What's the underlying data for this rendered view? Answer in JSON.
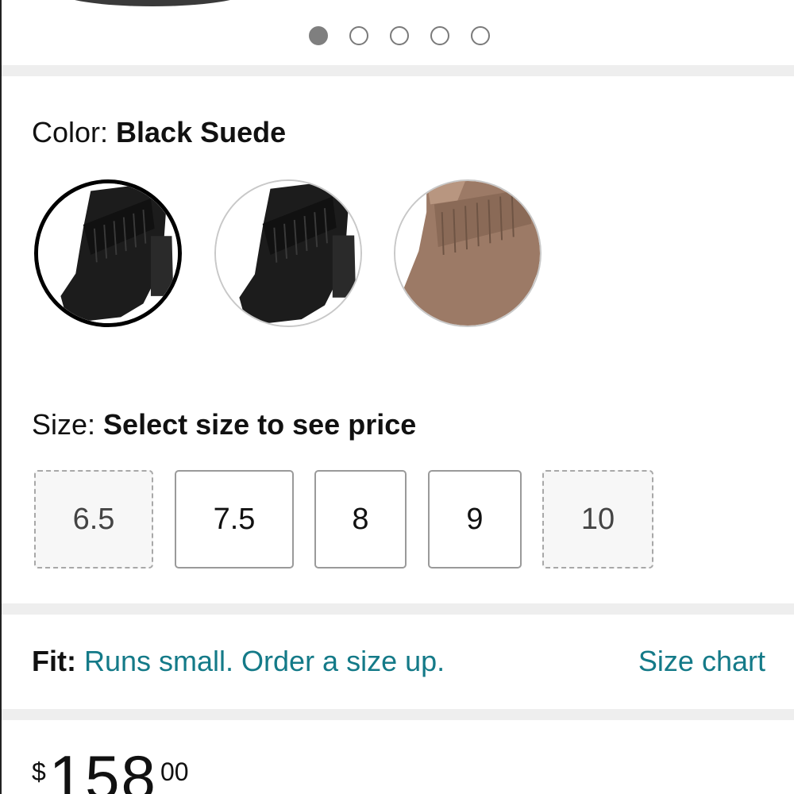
{
  "carousel": {
    "dots": [
      true,
      false,
      false,
      false,
      false
    ]
  },
  "color": {
    "label": "Color: ",
    "value": "Black Suede",
    "swatches": [
      {
        "name": "black-suede-swatch",
        "fill": "#1c1c1c",
        "selected": true
      },
      {
        "name": "black-suede-swatch-alt",
        "fill": "#1c1c1c",
        "selected": false
      },
      {
        "name": "taupe-suede-swatch",
        "fill": "#9c7a66",
        "selected": false
      }
    ]
  },
  "size": {
    "label": "Size: ",
    "value": "Select size to see price",
    "options": [
      {
        "label": "6.5",
        "available": false
      },
      {
        "label": "7.5",
        "available": true
      },
      {
        "label": "8",
        "available": true
      },
      {
        "label": "9",
        "available": true
      },
      {
        "label": "10",
        "available": false
      }
    ]
  },
  "fit": {
    "label": "Fit:",
    "text": "Runs small. Order a size up.",
    "size_chart_link": "Size chart"
  },
  "price": {
    "currency": "$",
    "whole": "158",
    "fraction": "00"
  },
  "colors": {
    "link": "#147a88",
    "divider": "#eeeeee"
  }
}
